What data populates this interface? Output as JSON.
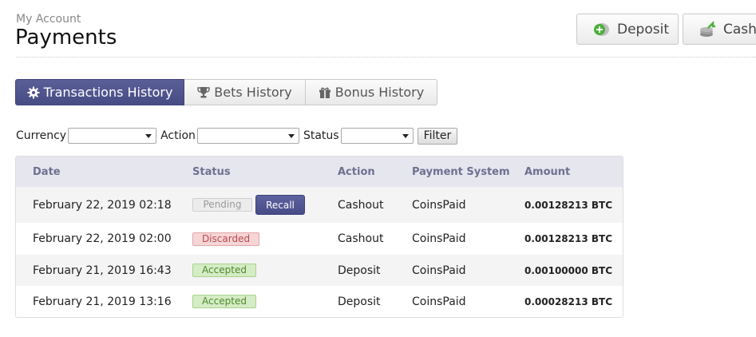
{
  "header": {
    "breadcrumb": "My Account",
    "title": "Payments",
    "deposit_label": "Deposit",
    "cashout_label": "Cashout"
  },
  "tabs": [
    {
      "label": "Transactions History",
      "icon": "gear-icon",
      "active": true
    },
    {
      "label": "Bets History",
      "icon": "trophy-icon",
      "active": false
    },
    {
      "label": "Bonus History",
      "icon": "gift-icon",
      "active": false
    }
  ],
  "filters": {
    "currency_label": "Currency",
    "currency_value": "",
    "action_label": "Action",
    "action_value": "",
    "status_label": "Status",
    "status_value": "",
    "filter_button": "Filter"
  },
  "table": {
    "columns": [
      "Date",
      "Status",
      "Action",
      "Payment System",
      "Amount"
    ],
    "rows": [
      {
        "date": "February 22, 2019 02:18",
        "status": "Pending",
        "action": "Cashout",
        "system": "CoinsPaid",
        "amount": "0.00128213 BTC",
        "recall": "Recall"
      },
      {
        "date": "February 22, 2019 02:00",
        "status": "Discarded",
        "action": "Cashout",
        "system": "CoinsPaid",
        "amount": "0.00128213 BTC"
      },
      {
        "date": "February 21, 2019 16:43",
        "status": "Accepted",
        "action": "Deposit",
        "system": "CoinsPaid",
        "amount": "0.00100000 BTC"
      },
      {
        "date": "February 21, 2019 13:16",
        "status": "Accepted",
        "action": "Deposit",
        "system": "CoinsPaid",
        "amount": "0.00028213 BTC"
      }
    ]
  },
  "colors": {
    "accent": "#4d5290",
    "pending": "#ececec",
    "discarded": "#f6d5d6",
    "accepted": "#d5ecc5",
    "header_row": "#e6e6ef"
  }
}
